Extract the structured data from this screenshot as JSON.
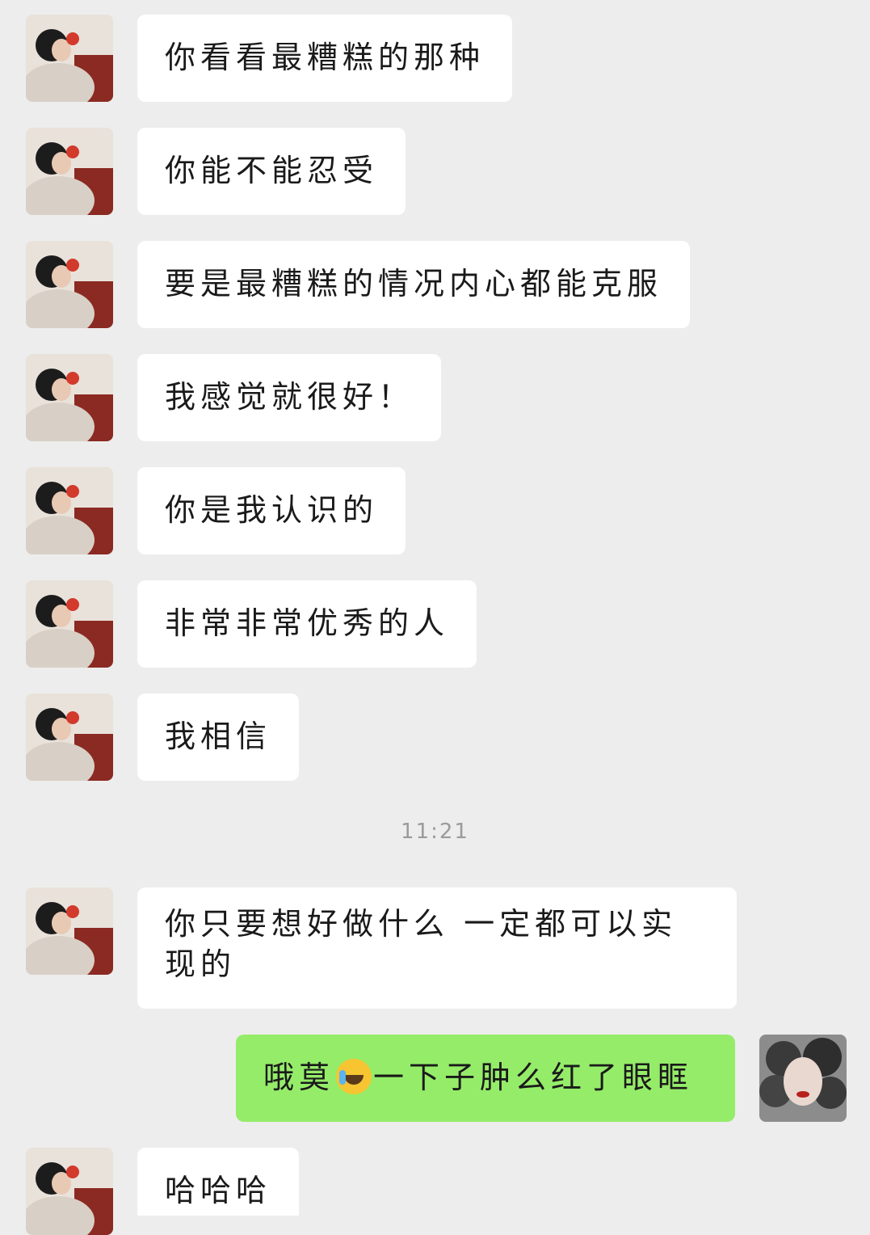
{
  "chat": {
    "messages": [
      {
        "side": "in",
        "text": "你看看最糟糕的那种"
      },
      {
        "side": "in",
        "text": "你能不能忍受"
      },
      {
        "side": "in",
        "text": "要是最糟糕的情况内心都能克服"
      },
      {
        "side": "in",
        "text": "我感觉就很好！"
      },
      {
        "side": "in",
        "text": "你是我认识的"
      },
      {
        "side": "in",
        "text": "非常非常优秀的人"
      },
      {
        "side": "in",
        "text": "我相信"
      },
      {
        "side": "in",
        "text": "你只要想好做什么 一定都可以实现的"
      },
      {
        "side": "out",
        "text_before": "哦莫",
        "emoji": "crying-face-emoji",
        "text_after": "一下子肿么红了眼眶"
      },
      {
        "side": "in",
        "text": "哈哈哈"
      }
    ],
    "timestamp": "11:21"
  },
  "colors": {
    "background": "#ededed",
    "incoming_bubble": "#ffffff",
    "outgoing_bubble": "#95ec69"
  }
}
